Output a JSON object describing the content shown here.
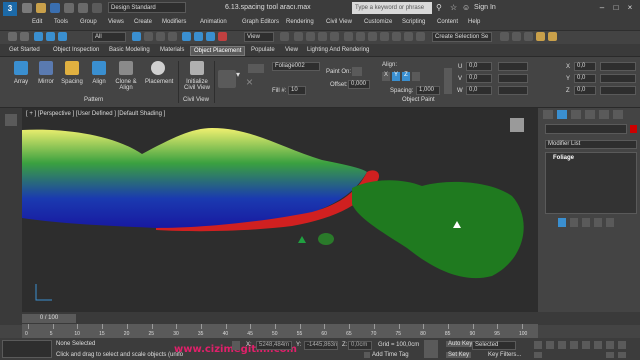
{
  "app": {
    "logo": "3",
    "workspace": "Design Standard",
    "title": "6.13.spacing tool aracı.max",
    "search_placeholder": "Type a keyword or phrase",
    "sign_in": "Sign In"
  },
  "menus": [
    "Edit",
    "Tools",
    "Group",
    "Views",
    "Create",
    "Modifiers",
    "Animation",
    "Graph Editors",
    "Rendering",
    "Civil View",
    "Customize",
    "Scripting",
    "Content",
    "Help"
  ],
  "toolbar": {
    "filter": "All",
    "view": "View",
    "selection_set": "Create Selection Se"
  },
  "ribbon_tabs": [
    {
      "label": "Get Started",
      "active": false
    },
    {
      "label": "Object Inspection",
      "active": false
    },
    {
      "label": "Basic Modeling",
      "active": false
    },
    {
      "label": "Materials",
      "active": false
    },
    {
      "label": "Object Placement",
      "active": true
    },
    {
      "label": "Populate",
      "active": false
    },
    {
      "label": "View",
      "active": false
    },
    {
      "label": "Lighting And Rendering",
      "active": false
    }
  ],
  "ribbon": {
    "buttons": [
      "Array",
      "Mirror",
      "Spacing",
      "Align",
      "Clone & Align",
      "Placement",
      "Initialize Civil View"
    ],
    "groups": [
      "Pattern",
      "Civil View",
      "Object Paint"
    ],
    "foliage_field": "Foliage002",
    "fill_label": "Fill #:",
    "fill_value": "10",
    "paint_on_label": "Paint On:",
    "offset_label": "Offset:",
    "offset_value": "0,000",
    "align_label": "Align:",
    "align_buttons": [
      "X",
      "Y",
      "Z"
    ],
    "spacing_label": "Spacing:",
    "spacing_value": "1,000",
    "u_label": "U",
    "v_label": "V",
    "w_label": "W",
    "x_label": "X",
    "y_label": "Y",
    "z_label": "Z",
    "u_value": "0,0",
    "v_value": "0,0",
    "w_value": "0,0",
    "x_value": "0,0",
    "y_value": "0,0",
    "z_value": "0,0"
  },
  "viewport": {
    "label": "[ + ] [Perspective ] [User Defined ] [Default Shading ]"
  },
  "command_panel": {
    "modifier_list": "Modifier List",
    "stack_item": "Foliage"
  },
  "timeline": {
    "frame": "0 / 100",
    "ticks": [
      "0",
      "5",
      "10",
      "15",
      "20",
      "25",
      "30",
      "35",
      "40",
      "45",
      "50",
      "55",
      "60",
      "65",
      "70",
      "75",
      "80",
      "85",
      "90",
      "95",
      "100"
    ]
  },
  "status": {
    "selection": "None Selected",
    "prompt": "Click and drag to select and scale objects (unifo",
    "x_label": "X:",
    "x_value": "5248,484m",
    "y_label": "Y:",
    "y_value": "-1445,863n",
    "z_label": "Z:",
    "z_value": "0,0cm",
    "grid": "Grid = 100,0cm",
    "add_time_tag": "Add Time Tag",
    "auto_key": "Auto Key",
    "selected": "Selected",
    "set_key": "Set Key",
    "key_filters": "Key Filters..."
  },
  "watermark": "www.cizimegitim.com",
  "colors": {
    "accent_blue": "#1c6aa8",
    "hill_yellow": "#e8e870",
    "hill_green": "#2c8a3c",
    "hill_blue": "#1a1aa0",
    "foliage_green": "#1f7a1f",
    "spline_red": "#d02020"
  }
}
